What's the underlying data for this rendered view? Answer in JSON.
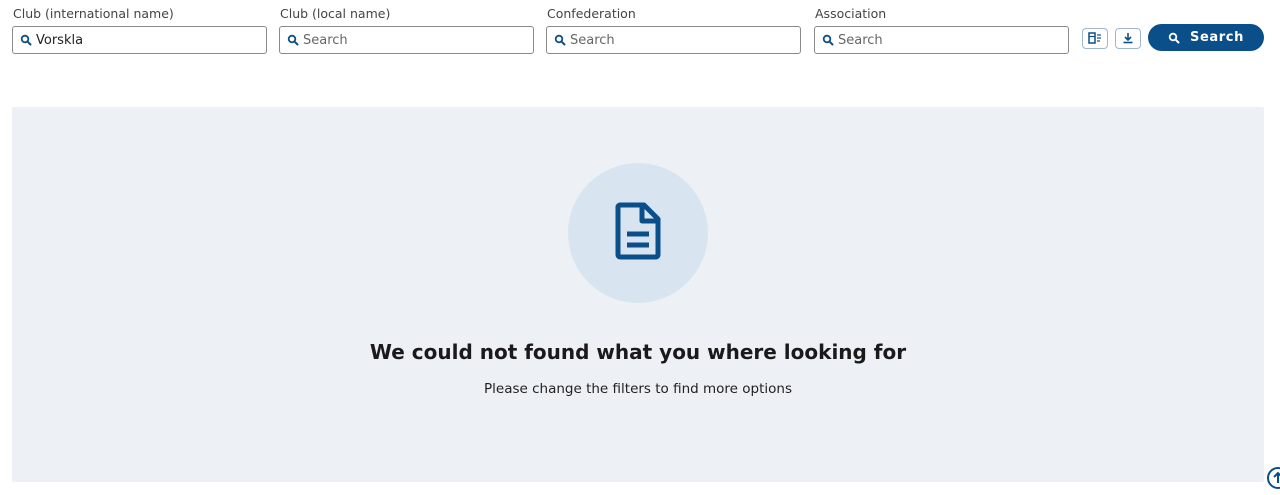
{
  "filters": {
    "club_international": {
      "label": "Club (international name)",
      "value": "Vorskla",
      "placeholder": "Search"
    },
    "club_local": {
      "label": "Club (local name)",
      "value": "",
      "placeholder": "Search"
    },
    "confederation": {
      "label": "Confederation",
      "value": "",
      "placeholder": "Search"
    },
    "association": {
      "label": "Association",
      "value": "",
      "placeholder": "Search"
    }
  },
  "actions": {
    "search_label": "Search"
  },
  "empty_state": {
    "title": "We could not found what you where looking for",
    "subtitle": "Please change the filters to find more options"
  },
  "colors": {
    "primary": "#0b4f8a",
    "panel_bg": "#edf1f5",
    "circle_bg": "#d8e5f0"
  },
  "icons": {
    "field_icon": "search-icon",
    "export_columns": "table-export-icon",
    "download": "download-icon",
    "empty_state": "document-icon",
    "corner": "scroll-up-icon"
  }
}
